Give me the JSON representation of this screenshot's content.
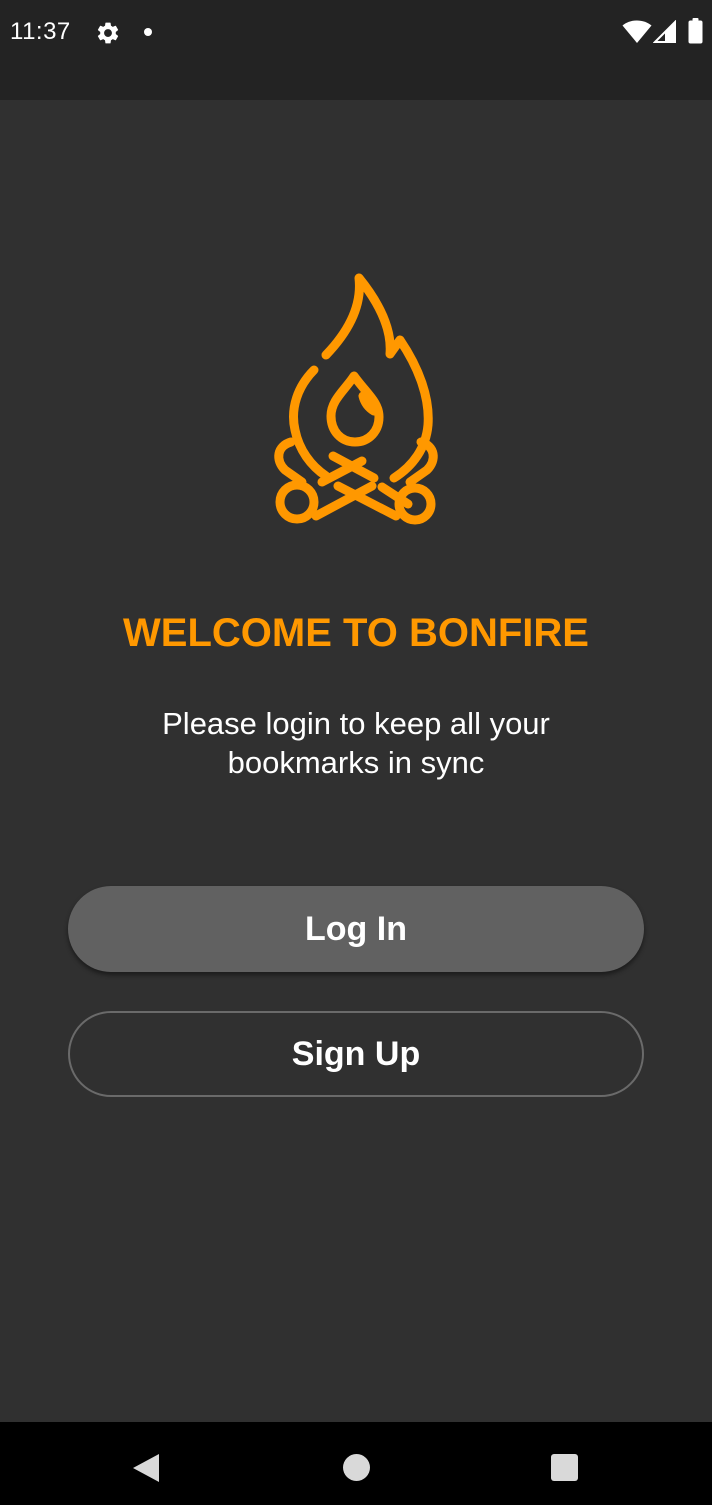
{
  "status_bar": {
    "time": "11:37",
    "icons": [
      "gear-icon",
      "notification-dot-icon",
      "wifi-icon",
      "cell-signal-icon",
      "battery-icon"
    ]
  },
  "welcome": {
    "logo_icon": "bonfire-icon",
    "title": "WELCOME TO BONFIRE",
    "subtitle": "Please login to keep all your bookmarks in sync"
  },
  "buttons": {
    "login_label": "Log In",
    "signup_label": "Sign Up"
  },
  "nav_bar": {
    "icons": [
      "back-icon",
      "home-icon",
      "recents-icon"
    ]
  },
  "colors": {
    "accent": "#ff9800",
    "background": "#303030",
    "status_bar": "#232323",
    "login_button": "#616161",
    "signup_border": "#6a6a6a",
    "text": "#ffffff"
  }
}
